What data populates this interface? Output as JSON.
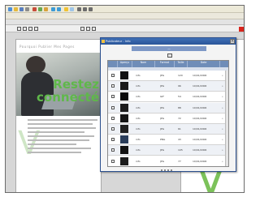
{
  "document": {
    "header_text": "Pourquoi Publier Mes Pages",
    "headline_1": "Restez",
    "headline_2": "connecté",
    "big_letter": "V"
  },
  "dialog": {
    "title": "Publicateur - Info",
    "tab_label": "—",
    "close_label": "×",
    "columns": [
      "",
      "Aperçu",
      "Nom",
      "Format",
      "Taille",
      "Date",
      ""
    ],
    "rows": [
      {
        "name": "info",
        "format": "JPG",
        "size": "120",
        "date": "10/01/2006"
      },
      {
        "name": "info",
        "format": "JPG",
        "size": "96",
        "date": "10/01/2006"
      },
      {
        "name": "info",
        "format": "GIF",
        "size": "54",
        "date": "10/01/2006"
      },
      {
        "name": "info",
        "format": "JPG",
        "size": "88",
        "date": "10/01/2006"
      },
      {
        "name": "info",
        "format": "JPG",
        "size": "72",
        "date": "10/01/2006"
      },
      {
        "name": "info",
        "format": "JPG",
        "size": "61",
        "date": "10/01/2006"
      },
      {
        "name": "info",
        "format": "PNG",
        "size": "43",
        "date": "10/01/2006"
      },
      {
        "name": "info",
        "format": "JPG",
        "size": "105",
        "date": "10/01/2006"
      },
      {
        "name": "info",
        "format": "JPG",
        "size": "77",
        "date": "10/01/2006"
      }
    ]
  },
  "colors": {
    "accent_green": "#5fb84a",
    "title_bar": "#2a5599",
    "header_blue": "#6f8db8"
  }
}
